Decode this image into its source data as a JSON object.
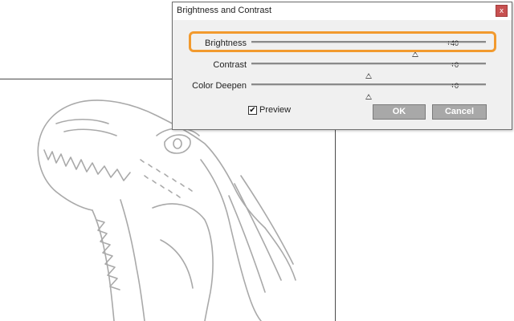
{
  "dialog": {
    "title": "Brightness and Contrast",
    "close_label": "x",
    "sliders": [
      {
        "label": "Brightness",
        "value_text": "+40",
        "level": 0.7
      },
      {
        "label": "Contrast",
        "value_text": "+0",
        "level": 0.5
      },
      {
        "label": "Color Deepen",
        "value_text": "+0",
        "level": 0.5
      }
    ],
    "preview": {
      "label": "Preview",
      "checked": true,
      "check_glyph": "✔"
    },
    "ok_label": "OK",
    "cancel_label": "Cancel"
  },
  "colors": {
    "highlight": "#f29a2e",
    "button_bg": "#a8a8a8",
    "close_bg": "#c75050"
  }
}
